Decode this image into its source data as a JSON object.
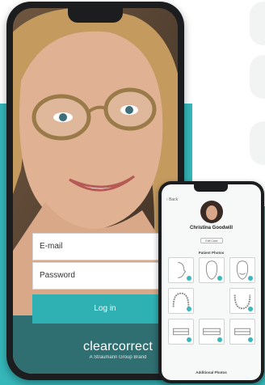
{
  "login": {
    "email_placeholder": "E-mail",
    "password_placeholder": "Password",
    "login_label": "Log in"
  },
  "brand": {
    "name": "clearcorrect",
    "tagline": "A Straumann Group Brand",
    "accent": "#35b7ba"
  },
  "patient_app": {
    "back_label": "Back",
    "patient_name": "Christina Goodwill",
    "edit_label": "Edit Case",
    "patient_photos_title": "Patient Photos",
    "additional_photos_title": "Additional Photos"
  }
}
